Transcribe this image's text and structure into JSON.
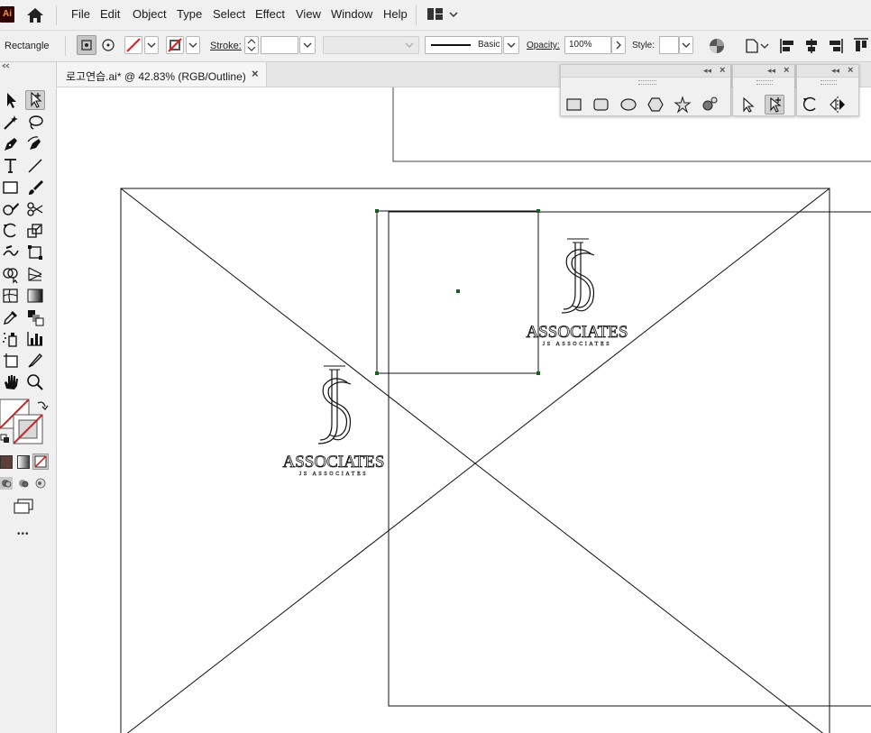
{
  "app": {
    "logo_text": "Ai",
    "menu": [
      "File",
      "Edit",
      "Object",
      "Type",
      "Select",
      "Effect",
      "View",
      "Window",
      "Help"
    ]
  },
  "control_bar": {
    "selection_type": "Rectangle",
    "stroke_label": "Stroke:",
    "stroke_value": "",
    "brush_value": "Basic",
    "opacity_label": "Opacity:",
    "opacity_value": "100%",
    "style_label": "Style:"
  },
  "document": {
    "tab_title": "로고연습.ai* @ 42.83% (RGB/Outline)",
    "close_glyph": "×"
  },
  "toolbar": {
    "tools": [
      "selection-tool",
      "direct-selection-tool",
      "magic-wand-tool",
      "lasso-tool",
      "pen-tool",
      "curvature-tool",
      "type-tool",
      "line-tool",
      "rectangle-tool",
      "paintbrush-tool",
      "shaper-tool",
      "scissors-tool",
      "rotate-tool",
      "scale-tool",
      "warp-tool",
      "free-transform-tool",
      "shape-builder-tool",
      "perspective-grid-tool",
      "mesh-tool",
      "gradient-tool",
      "eyedropper-tool",
      "blend-tool",
      "symbol-sprayer-tool",
      "column-graph-tool",
      "artboard-tool",
      "slice-tool",
      "hand-tool",
      "zoom-tool"
    ],
    "more_glyph": "•••"
  },
  "floating_panels": {
    "shapes": [
      "rectangle-icon",
      "rounded-rectangle-icon",
      "ellipse-icon",
      "polygon-icon",
      "star-icon",
      "flare-icon"
    ],
    "selection": [
      "selection-arrow-icon",
      "direct-selection-arrow-icon"
    ],
    "transform": [
      "rotate-icon",
      "reflect-icon"
    ]
  },
  "artwork": {
    "logo_main": "ASSOCIATES",
    "logo_sub": "JS ASSOCIATES",
    "logo_mark": "JS"
  },
  "colors": {
    "selection_accent": "#1b5e20",
    "ui_gray": "#f0f0f0"
  }
}
